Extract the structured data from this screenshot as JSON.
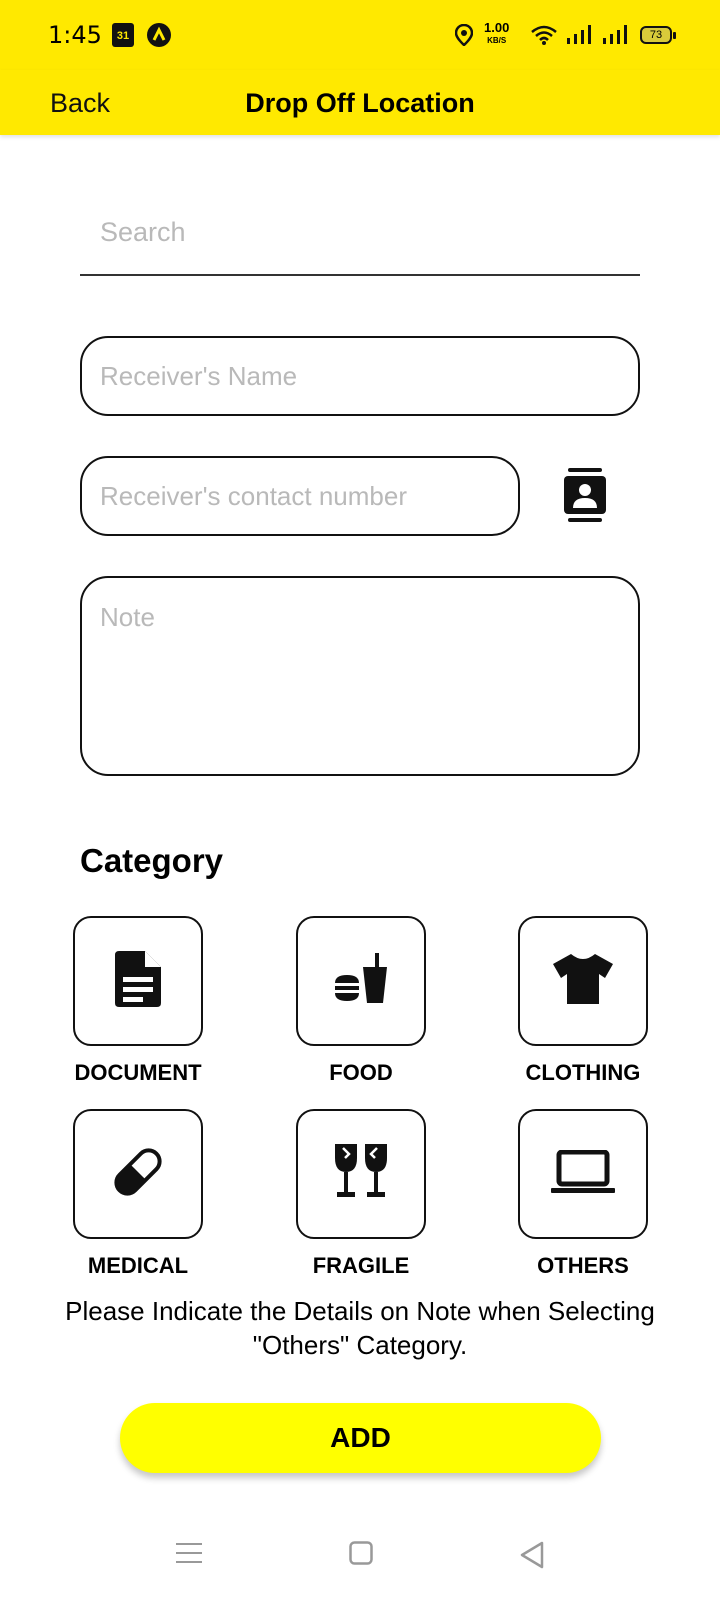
{
  "status_bar": {
    "time": "1:45",
    "calendar_day": "31",
    "network_speed": "1.00",
    "network_speed_unit": "KB/S",
    "battery_level": "73"
  },
  "header": {
    "back_label": "Back",
    "title": "Drop Off Location"
  },
  "form": {
    "search_placeholder": "Search",
    "receiver_name_placeholder": "Receiver's Name",
    "receiver_contact_placeholder": "Receiver's contact number",
    "note_placeholder": "Note"
  },
  "category": {
    "title": "Category",
    "items": [
      {
        "label": "DOCUMENT",
        "icon": "document-icon"
      },
      {
        "label": "FOOD",
        "icon": "food-icon"
      },
      {
        "label": "CLOTHING",
        "icon": "clothing-icon"
      },
      {
        "label": "MEDICAL",
        "icon": "medical-icon"
      },
      {
        "label": "FRAGILE",
        "icon": "fragile-icon"
      },
      {
        "label": "OTHERS",
        "icon": "laptop-icon"
      }
    ]
  },
  "hint_text": "Please Indicate the Details on Note when Selecting \"Others\" Category.",
  "add_button_label": "ADD",
  "colors": {
    "header_yellow": "#ffe900",
    "button_yellow": "#ffff00"
  }
}
